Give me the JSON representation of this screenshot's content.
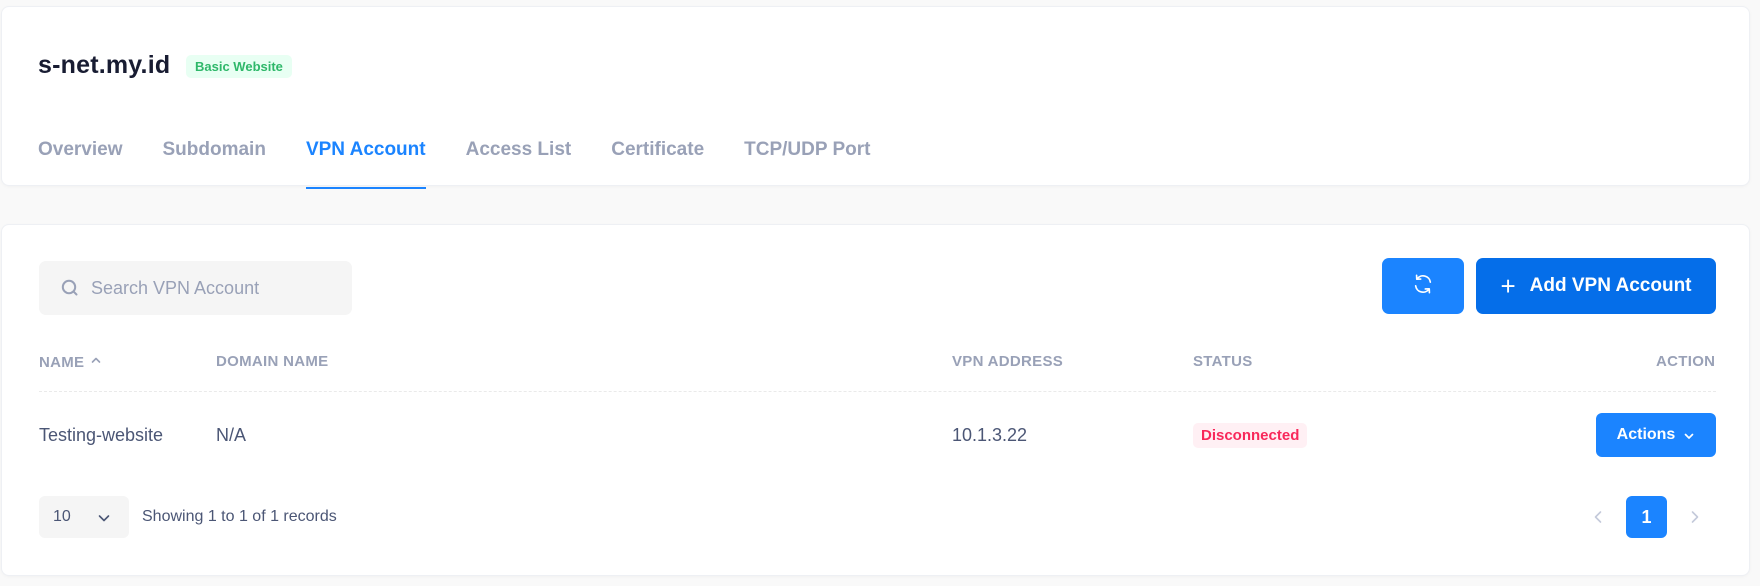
{
  "header": {
    "site_name": "s-net.my.id",
    "plan_badge": "Basic Website",
    "tabs": [
      {
        "label": "Overview",
        "active": false
      },
      {
        "label": "Subdomain",
        "active": false
      },
      {
        "label": "VPN Account",
        "active": true
      },
      {
        "label": "Access List",
        "active": false
      },
      {
        "label": "Certificate",
        "active": false
      },
      {
        "label": "TCP/UDP Port",
        "active": false
      }
    ]
  },
  "toolbar": {
    "search_placeholder": "Search VPN Account",
    "search_value": "",
    "refresh_icon": "refresh-icon",
    "add_label": "Add VPN Account",
    "add_icon": "plus-icon"
  },
  "table": {
    "columns": {
      "name": "NAME",
      "domain": "DOMAIN NAME",
      "vpn_address": "VPN ADDRESS",
      "status": "STATUS",
      "action": "ACTION"
    },
    "sort": {
      "column": "name",
      "direction": "asc"
    },
    "rows": [
      {
        "name": "Testing-website",
        "domain": "N/A",
        "vpn_address": "10.1.3.22",
        "status": "Disconnected",
        "action_label": "Actions"
      }
    ]
  },
  "footer": {
    "page_size": "10",
    "records_text": "Showing 1 to 1 of 1 records",
    "current_page": "1"
  },
  "colors": {
    "primary": "#1b84ff",
    "primary_dark": "#056ee9",
    "success_badge_bg": "#e8fff3",
    "success_badge_text": "#2fb86a",
    "danger_badge_bg": "#fff0f4",
    "danger_badge_text": "#f8285a",
    "muted_text": "#99a1b7"
  }
}
